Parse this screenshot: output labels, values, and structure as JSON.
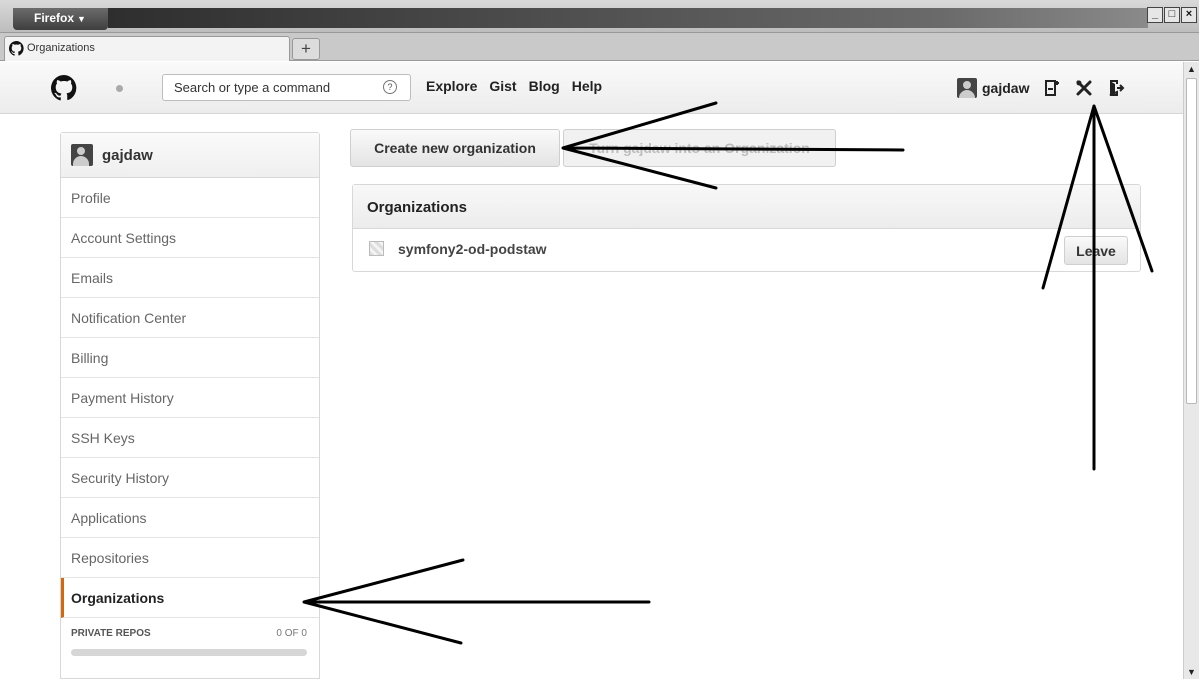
{
  "browser": {
    "menu_label": "Firefox",
    "menu_caret": "▼",
    "tab_title": "Organizations",
    "new_tab": "+",
    "window_controls": [
      "_",
      "□",
      "×"
    ]
  },
  "header": {
    "search": {
      "placeholder": "Search or type a command",
      "help": "?"
    },
    "nav": [
      "Explore",
      "Gist",
      "Blog",
      "Help"
    ],
    "username": "gajdaw",
    "icons": [
      "repo-create-icon",
      "settings-tools-icon",
      "sign-out-icon"
    ]
  },
  "sidebar": {
    "username": "gajdaw",
    "items": [
      {
        "label": "Profile",
        "selected": false
      },
      {
        "label": "Account Settings",
        "selected": false
      },
      {
        "label": "Emails",
        "selected": false
      },
      {
        "label": "Notification Center",
        "selected": false
      },
      {
        "label": "Billing",
        "selected": false
      },
      {
        "label": "Payment History",
        "selected": false
      },
      {
        "label": "SSH Keys",
        "selected": false
      },
      {
        "label": "Security History",
        "selected": false
      },
      {
        "label": "Applications",
        "selected": false
      },
      {
        "label": "Repositories",
        "selected": false
      },
      {
        "label": "Organizations",
        "selected": true
      }
    ],
    "private_repos": {
      "label": "PRIVATE REPOS",
      "value": "0 OF 0",
      "used_fraction": 0
    }
  },
  "main": {
    "create_button": "Create new organization",
    "turn_button": "Turn gajdaw into an Organization",
    "organizations": {
      "title": "Organizations",
      "rows": [
        {
          "name": "symfony2-od-podstaw",
          "action": "Leave"
        }
      ]
    }
  },
  "colors": {
    "selected_accent": "#d26911"
  }
}
